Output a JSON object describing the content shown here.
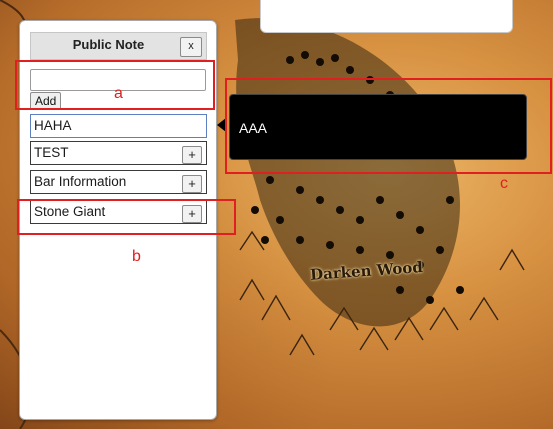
{
  "map": {
    "place_label": "Darken Wood"
  },
  "panel": {
    "title": "Public Note",
    "close_label": "x",
    "input_value": "",
    "add_label": "Add",
    "notes": [
      {
        "label": "HAHA",
        "selected": true,
        "has_plus": false
      },
      {
        "label": "TEST",
        "selected": false,
        "has_plus": true
      },
      {
        "label": "Bar Information",
        "selected": false,
        "has_plus": true
      },
      {
        "label": "Stone Giant",
        "selected": false,
        "has_plus": true
      }
    ],
    "plus_label": "+"
  },
  "tooltip": {
    "text": "AAA"
  },
  "annotations": {
    "a": "a",
    "b": "b",
    "c": "c",
    "color": "#e02020"
  }
}
